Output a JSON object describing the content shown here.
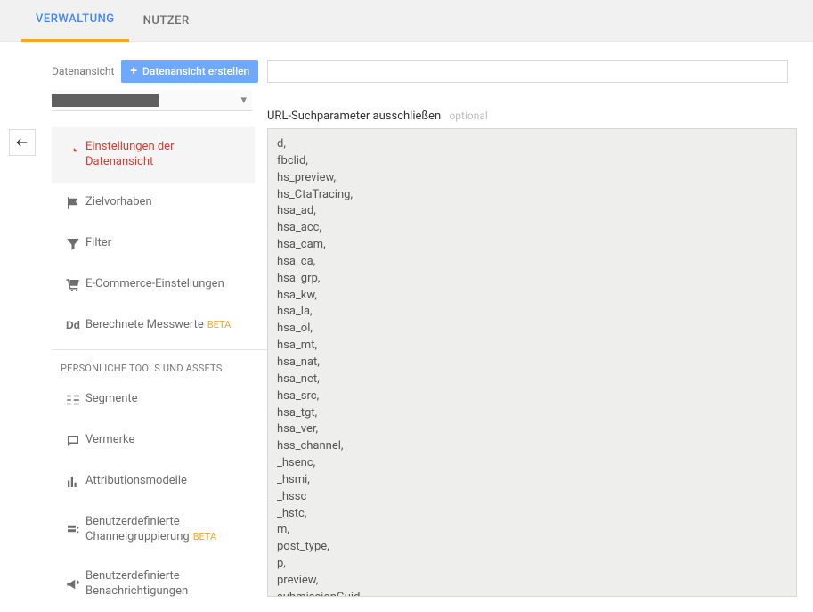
{
  "tabs": {
    "admin": "VERWALTUNG",
    "user": "NUTZER"
  },
  "left": {
    "breadcrumb_label": "Datenansicht",
    "create_btn": "Datenansicht erstellen",
    "selector_value": ""
  },
  "nav": [
    {
      "label": "Einstellungen der\nDatenansicht",
      "icon": "doc",
      "active": true
    },
    {
      "label": "Zielvorhaben",
      "icon": "flag"
    },
    {
      "label": "Filter",
      "icon": "funnel"
    },
    {
      "label": "E-Commerce-Einstellungen",
      "icon": "cart"
    },
    {
      "label": "Berechnete Messwerte",
      "icon": "dd",
      "beta": "BETA"
    }
  ],
  "section_head": "PERSÖNLICHE TOOLS UND ASSETS",
  "nav2": [
    {
      "label": "Segmente",
      "icon": "segments"
    },
    {
      "label": "Vermerke",
      "icon": "note"
    },
    {
      "label": "Attributionsmodelle",
      "icon": "bars"
    },
    {
      "label": "Benutzerdefinierte\nChannelgruppierung",
      "icon": "channel",
      "beta": "BETA"
    },
    {
      "label": "Benutzerdefinierte\nBenachrichtigungen",
      "icon": "megaphone"
    }
  ],
  "right": {
    "field_label": "URL-Suchparameter ausschließen",
    "optional": "optional",
    "textarea_value": "d,\nfbclid,\nhs_preview,\nhs_CtaTracing,\nhsa_ad,\nhsa_acc,\nhsa_cam,\nhsa_ca,\nhsa_grp,\nhsa_kw,\nhsa_la,\nhsa_ol,\nhsa_mt,\nhsa_nat,\nhsa_net,\nhsa_src,\nhsa_tgt,\nhsa_ver,\nhss_channel,\n_hsenc,\n_hsmi,\n_hssc\n_hstc,\nm,\npost_type,\np,\npreview,\nsubmissionGuid,"
  }
}
